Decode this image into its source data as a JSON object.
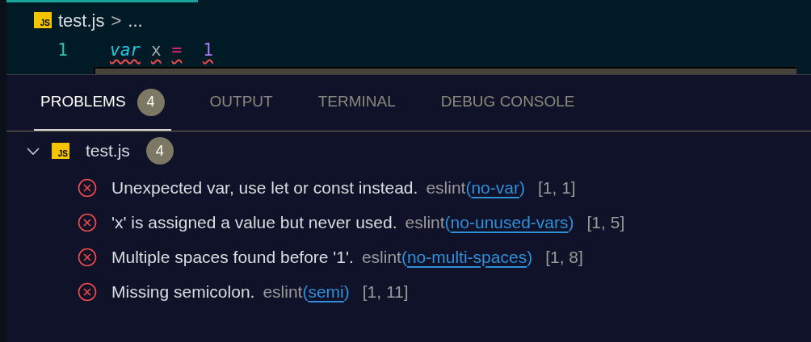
{
  "breadcrumb": {
    "file_icon": "JS",
    "file": "test.js",
    "separator": ">",
    "more": "..."
  },
  "editor": {
    "lines": [
      {
        "number": "1",
        "tokens": [
          {
            "kind": "keyword",
            "text": "var"
          },
          {
            "kind": "ident",
            "text": "x"
          },
          {
            "kind": "operator",
            "text": "="
          },
          {
            "kind": "number",
            "text": "1"
          }
        ],
        "error": true
      }
    ]
  },
  "panel": {
    "tabs": [
      {
        "label": "PROBLEMS",
        "badge": "4",
        "selected": true
      },
      {
        "label": "OUTPUT",
        "selected": false
      },
      {
        "label": "TERMINAL",
        "selected": false
      },
      {
        "label": "DEBUG CONSOLE",
        "selected": false
      }
    ],
    "files": [
      {
        "expanded": true,
        "icon": "JS",
        "name": "test.js",
        "count": "4",
        "problems": [
          {
            "kind": "error",
            "message": "Unexpected var, use let or const instead.",
            "source": "eslint",
            "open": "(",
            "code": "no-var",
            "close": ")",
            "position": "[1, 1]"
          },
          {
            "kind": "error",
            "message": "'x' is assigned a value but never used.",
            "source": "eslint",
            "open": "(",
            "code": "no-unused-vars",
            "close": ")",
            "position": "[1, 5]"
          },
          {
            "kind": "error",
            "message": "Multiple spaces found before '1'.",
            "source": "eslint",
            "open": "(",
            "code": "no-multi-spaces",
            "close": ")",
            "position": "[1, 8]"
          },
          {
            "kind": "error",
            "message": "Missing semicolon.",
            "source": "eslint",
            "open": "(",
            "code": "semi",
            "close": ")",
            "position": "[1, 11]"
          }
        ]
      }
    ]
  }
}
